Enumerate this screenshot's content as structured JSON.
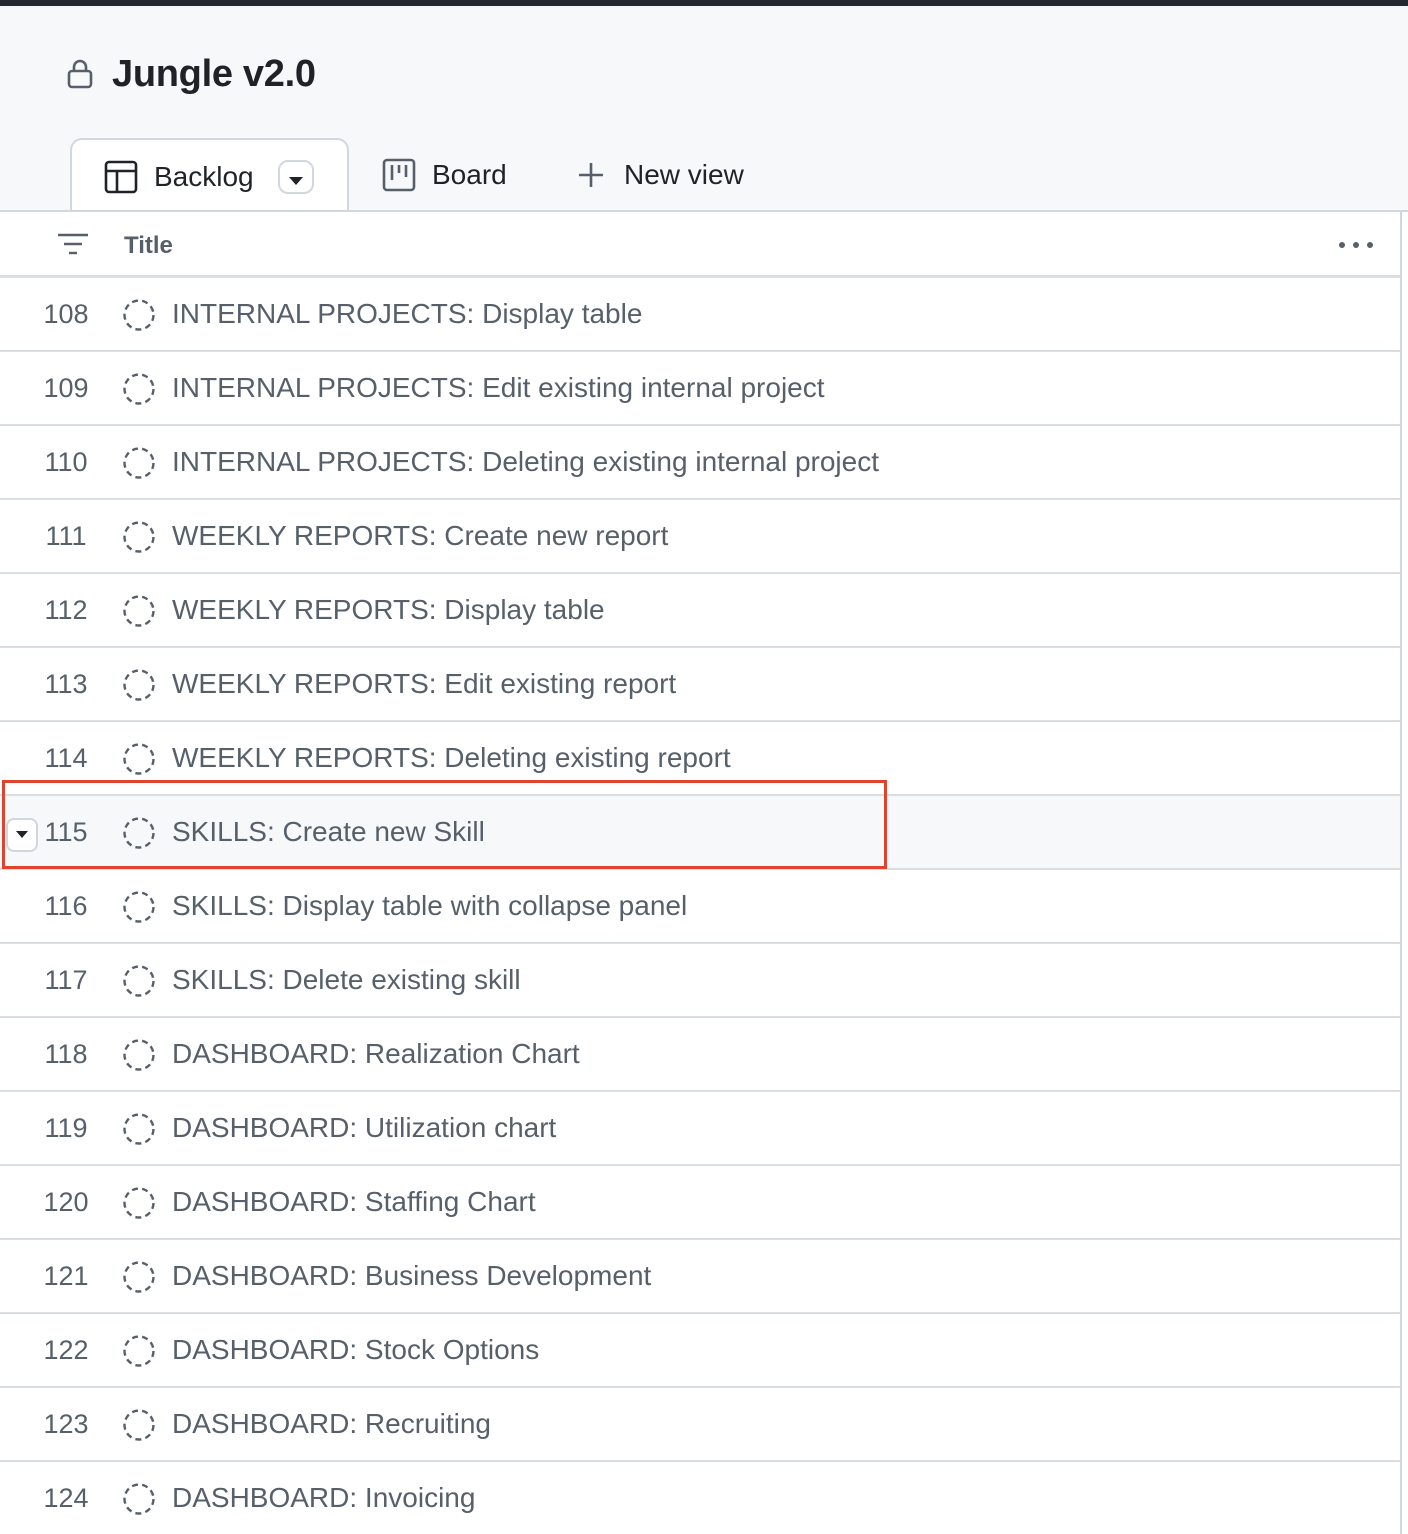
{
  "project": {
    "title": "Jungle v2.0",
    "icon": "lock-icon"
  },
  "tabs": [
    {
      "label": "Backlog",
      "icon": "table-icon",
      "active": true
    },
    {
      "label": "Board",
      "icon": "board-icon",
      "active": false
    },
    {
      "label": "New view",
      "icon": "plus-icon",
      "active": false
    }
  ],
  "table": {
    "column_title": "Title",
    "rows": [
      {
        "number": "108",
        "title": "INTERNAL PROJECTS: Display table"
      },
      {
        "number": "109",
        "title": "INTERNAL PROJECTS: Edit existing internal project"
      },
      {
        "number": "110",
        "title": "INTERNAL PROJECTS: Deleting existing internal project"
      },
      {
        "number": "111",
        "title": "WEEKLY REPORTS: Create new report"
      },
      {
        "number": "112",
        "title": "WEEKLY REPORTS: Display table"
      },
      {
        "number": "113",
        "title": "WEEKLY REPORTS: Edit existing report"
      },
      {
        "number": "114",
        "title": "WEEKLY REPORTS: Deleting existing report"
      },
      {
        "number": "115",
        "title": "SKILLS: Create new Skill",
        "highlighted": true
      },
      {
        "number": "116",
        "title": "SKILLS: Display table with collapse panel"
      },
      {
        "number": "117",
        "title": "SKILLS: Delete existing skill"
      },
      {
        "number": "118",
        "title": "DASHBOARD: Realization Chart"
      },
      {
        "number": "119",
        "title": "DASHBOARD: Utilization chart"
      },
      {
        "number": "120",
        "title": "DASHBOARD: Staffing Chart"
      },
      {
        "number": "121",
        "title": "DASHBOARD: Business Development"
      },
      {
        "number": "122",
        "title": "DASHBOARD: Stock Options"
      },
      {
        "number": "123",
        "title": "DASHBOARD: Recruiting"
      },
      {
        "number": "124",
        "title": "DASHBOARD: Invoicing"
      }
    ]
  },
  "colors": {
    "highlight_border": "#e0442f",
    "header_bg": "#f6f8fa",
    "top_bar": "#24292f"
  }
}
